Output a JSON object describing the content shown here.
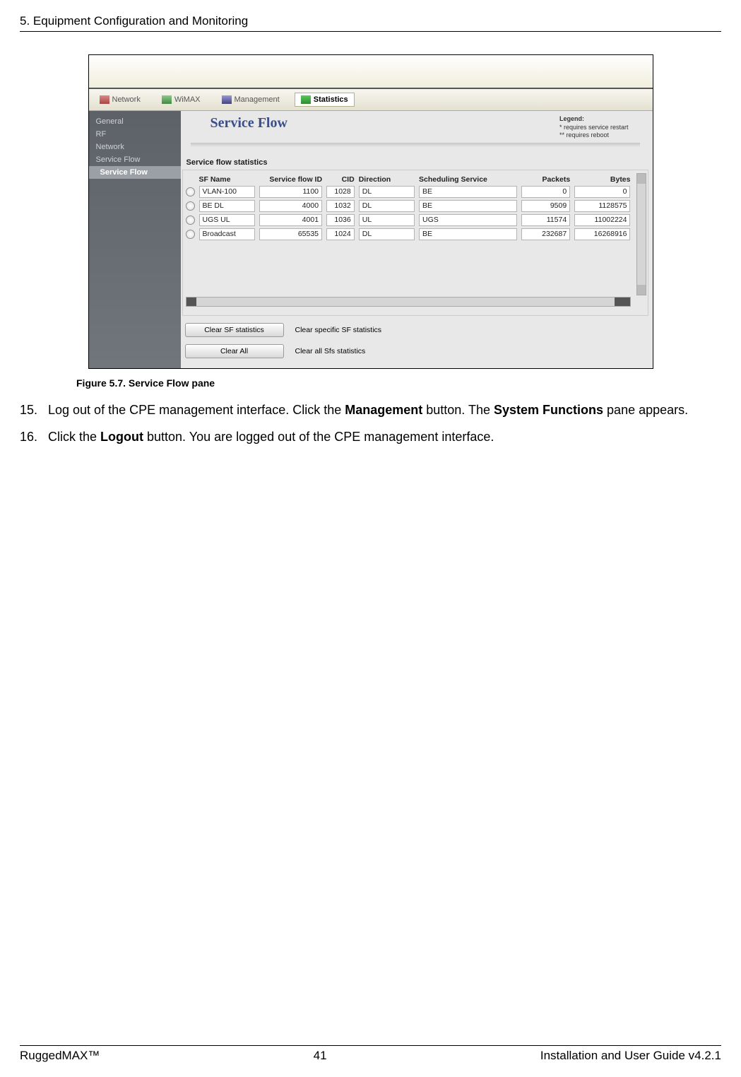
{
  "header": "5. Equipment Configuration and Monitoring",
  "figure_caption": "Figure 5.7. Service Flow pane",
  "steps": [
    {
      "num": "15.",
      "text_a": "Log out of the CPE management interface. Click the ",
      "b1": "Management",
      "text_b": " button. The ",
      "b2": "System Functions",
      "text_c": " pane appears."
    },
    {
      "num": "16.",
      "text_a": "Click the ",
      "b1": "Logout",
      "text_b": " button. You are logged out of the CPE management interface.",
      "b2": "",
      "text_c": ""
    }
  ],
  "nav": [
    {
      "label": "Network",
      "icon": "ic1"
    },
    {
      "label": "WiMAX",
      "icon": "ic2"
    },
    {
      "label": "Management",
      "icon": "ic3"
    },
    {
      "label": "Statistics",
      "icon": "ic4",
      "active": true
    }
  ],
  "sidebar": [
    {
      "label": "General"
    },
    {
      "label": "RF"
    },
    {
      "label": "Network"
    },
    {
      "label": "Service Flow"
    },
    {
      "label": "Service Flow",
      "active": true
    }
  ],
  "panel": {
    "title": "Service Flow",
    "legend_title": "Legend:",
    "legend_l1": "*  requires service restart",
    "legend_l2": "** requires reboot",
    "section": "Service flow statistics"
  },
  "columns": [
    "SF Name",
    "Service flow ID",
    "CID",
    "Direction",
    "Scheduling Service",
    "Packets",
    "Bytes"
  ],
  "rows": [
    {
      "name": "VLAN-100",
      "sfid": "1100",
      "cid": "1028",
      "dir": "DL",
      "sched": "BE",
      "pkt": "0",
      "byt": "0"
    },
    {
      "name": "BE DL",
      "sfid": "4000",
      "cid": "1032",
      "dir": "DL",
      "sched": "BE",
      "pkt": "9509",
      "byt": "1128575"
    },
    {
      "name": "UGS UL",
      "sfid": "4001",
      "cid": "1036",
      "dir": "UL",
      "sched": "UGS",
      "pkt": "11574",
      "byt": "11002224"
    },
    {
      "name": "Broadcast",
      "sfid": "65535",
      "cid": "1024",
      "dir": "DL",
      "sched": "BE",
      "pkt": "232687",
      "byt": "16268916"
    }
  ],
  "buttons": [
    {
      "label": "Clear SF statistics",
      "desc": "Clear specific SF statistics"
    },
    {
      "label": "Clear All",
      "desc": "Clear all Sfs statistics"
    }
  ],
  "footer": {
    "left": "RuggedMAX™",
    "center": "41",
    "right": "Installation and User Guide v4.2.1"
  }
}
